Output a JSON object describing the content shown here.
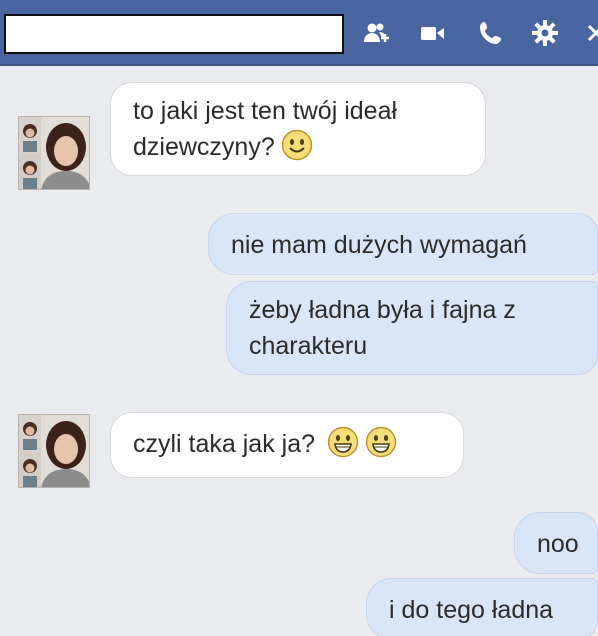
{
  "header": {
    "contact_name": "",
    "icons": [
      "add-people-icon",
      "video-call-icon",
      "phone-call-icon",
      "gear-icon",
      "close-icon"
    ],
    "background_color": "#4a66a0"
  },
  "messages": [
    {
      "sender": "them",
      "lines": [
        "to jaki jest ten twój ideał",
        "dziewczyny?"
      ],
      "emoji_count": 1
    },
    {
      "sender": "me",
      "lines": [
        "nie mam dużych wymagań"
      ]
    },
    {
      "sender": "me",
      "lines": [
        "żeby ładna była i fajna z",
        "charakteru"
      ]
    },
    {
      "sender": "them",
      "lines": [
        "czyli taka jak ja?"
      ],
      "emoji_count": 2
    },
    {
      "sender": "me",
      "lines": [
        "noo"
      ]
    },
    {
      "sender": "me",
      "lines": [
        "i do tego ładna"
      ]
    }
  ],
  "colors": {
    "incoming_bubble": "#ffffff",
    "outgoing_bubble": "#d9e6f8",
    "background": "#e9ebee"
  }
}
